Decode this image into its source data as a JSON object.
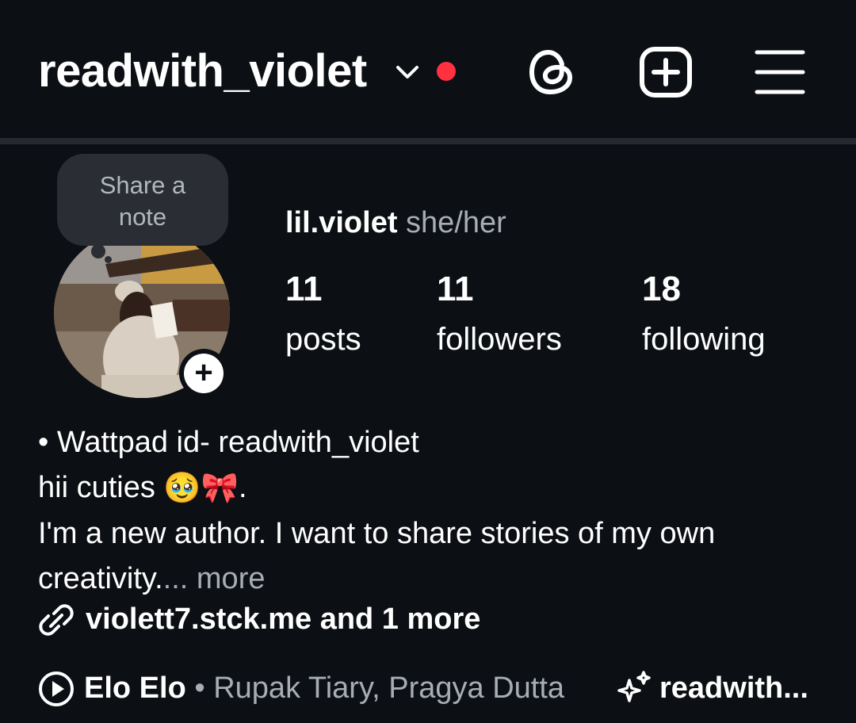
{
  "header": {
    "username": "readwith_violet",
    "icons": [
      "chevron-down-icon",
      "notification-dot",
      "threads-icon",
      "create-post-icon",
      "menu-icon"
    ],
    "notification_color": "#ff3040"
  },
  "profile": {
    "note_prompt_line1": "Share a",
    "note_prompt_line2": "note",
    "display_name": "lil.violet",
    "pronouns": "she/her",
    "stats": [
      {
        "value": "11",
        "label": "posts"
      },
      {
        "value": "11",
        "label": "followers"
      },
      {
        "value": "18",
        "label": "following"
      }
    ],
    "add_story_symbol": "+"
  },
  "bio": {
    "line1": "• Wattpad id-  readwith_violet",
    "line2_text": "hii cuties",
    "line2_emojis": "🥹🎀",
    "line2_end": ".",
    "line3": "I'm a new author. I want to share stories of my own",
    "line4": "creativity.",
    "line4_more": "... more"
  },
  "link": {
    "text": "violett7.stck.me and 1 more",
    "icon": "link-icon"
  },
  "music": {
    "song": "Elo Elo",
    "separator": " • ",
    "artists": "Rupak Tiary, Pragya Dutta",
    "icon": "play-circle-icon"
  },
  "ai_label": {
    "text": "readwith...",
    "icon": "sparkle-icon"
  },
  "colors": {
    "background": "#0c0f14",
    "text": "#ffffff",
    "muted": "#a8adb5",
    "divider": "#262a30"
  }
}
